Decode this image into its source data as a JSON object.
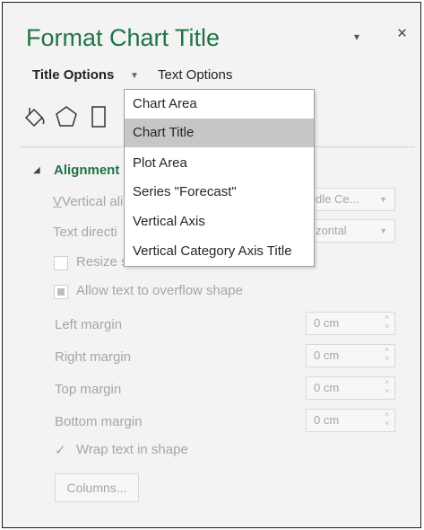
{
  "pane": {
    "title": "Format Chart Title",
    "pin_glyph": "▾",
    "close_glyph": "×"
  },
  "tabs": {
    "title_options": "Title Options",
    "text_options": "Text Options",
    "dropdown_glyph": "▼"
  },
  "icons": [
    "fill-line-icon",
    "effects-pentagon-icon",
    "size-properties-icon"
  ],
  "section": {
    "title": "Alignment",
    "collapse_glyph": "◢"
  },
  "alignment": {
    "vertical_alignment_label_visible": "Vertical ali",
    "vertical_alignment_value_visible": "dle Ce...",
    "text_direction_label_visible": "Text directi",
    "text_direction_value_visible": "zontal",
    "resize_label_visible": "Resize s",
    "allow_overflow_label": "Allow text to overflow shape",
    "left_margin_label": "Left margin",
    "left_margin_value": "0 cm",
    "right_margin_label": "Right margin",
    "right_margin_value": "0 cm",
    "top_margin_label": "Top margin",
    "top_margin_value": "0 cm",
    "bottom_margin_label": "Bottom margin",
    "bottom_margin_value": "0 cm",
    "wrap_text_label": "Wrap text in shape",
    "columns_button": "Columns..."
  },
  "menu": {
    "items": [
      {
        "label": "Chart Area",
        "selected": false
      },
      {
        "label": "Chart Title",
        "selected": true
      },
      {
        "label": "Plot Area",
        "selected": false
      },
      {
        "label": "Series \"Forecast\"",
        "selected": false
      },
      {
        "label": "Vertical Axis",
        "selected": false
      },
      {
        "label": "Vertical Category Axis Title",
        "selected": false
      }
    ]
  },
  "colors": {
    "accent": "#217346",
    "disabled_text": "#a6a6a6",
    "selected_item": "#c6c6c6"
  }
}
